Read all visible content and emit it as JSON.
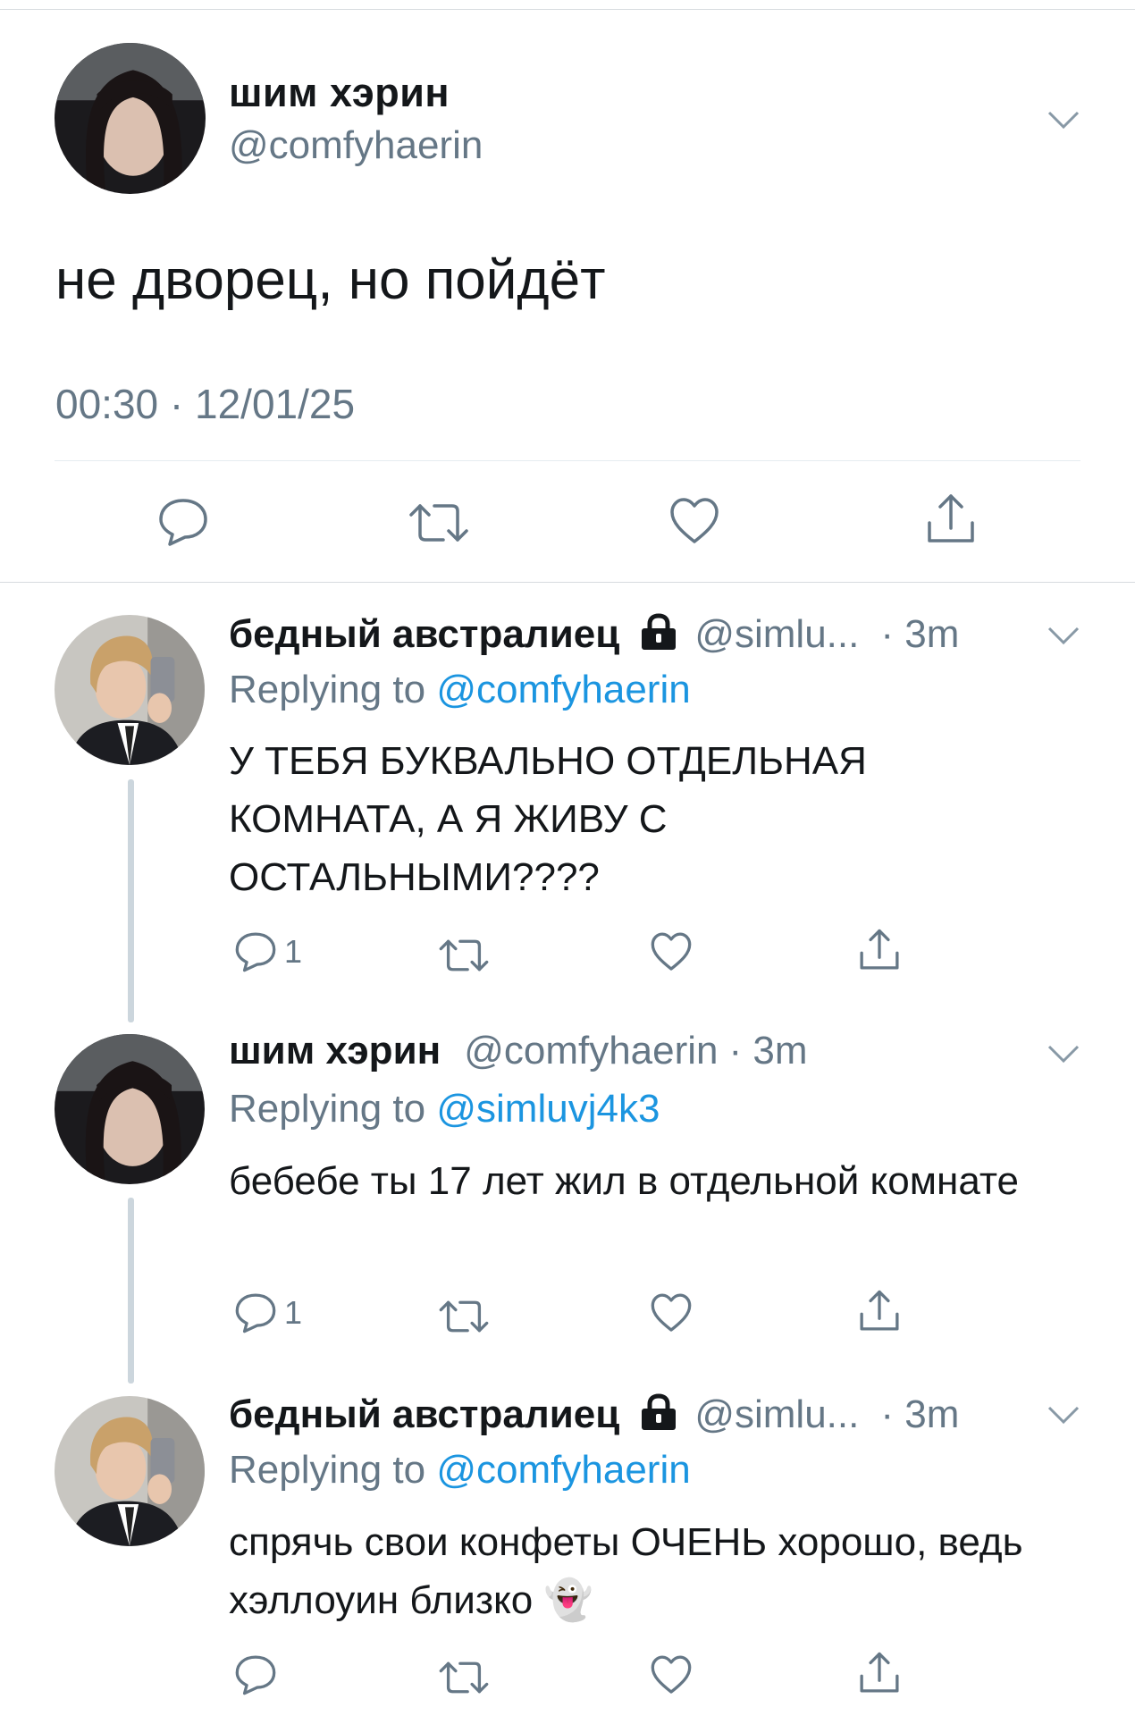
{
  "main_tweet": {
    "author_name": "шим хэрин",
    "author_handle": "@comfyhaerin",
    "text": "не дворец, но пойдёт",
    "timestamp": "00:30 · 12/01/25"
  },
  "replies": [
    {
      "author_name": "бедный австралиец",
      "author_handle": "@simlu...",
      "time": "· 3m",
      "replying_prefix": "Replying to ",
      "replying_to": "@comfyhaerin",
      "text": "У ТЕБЯ БУКВАЛЬНО ОТДЕЛЬНАЯ КОМНАТА, А Я ЖИВУ С ОСТАЛЬНЫМИ????",
      "reply_count": "1"
    },
    {
      "author_name": "шим хэрин",
      "author_handle": "@comfyhaerin",
      "time": "· 3m",
      "replying_prefix": "Replying to ",
      "replying_to": "@simluvj4k3",
      "text": "бебебе ты 17 лет жил в отдельной комнате",
      "reply_count": "1"
    },
    {
      "author_name": "бедный австралиец",
      "author_handle": "@simlu...",
      "time": "· 3m",
      "replying_prefix": "Replying to ",
      "replying_to": "@comfyhaerin",
      "text": "спрячь свои конфеты ОЧЕНЬ хорошо, ведь хэллоуин близко 👻",
      "reply_count": ""
    }
  ],
  "colors": {
    "text": "#14171a",
    "secondary": "#657786",
    "link": "#1b95e0",
    "divider": "#e6ecf0",
    "thread_line": "#ccd6dd"
  }
}
